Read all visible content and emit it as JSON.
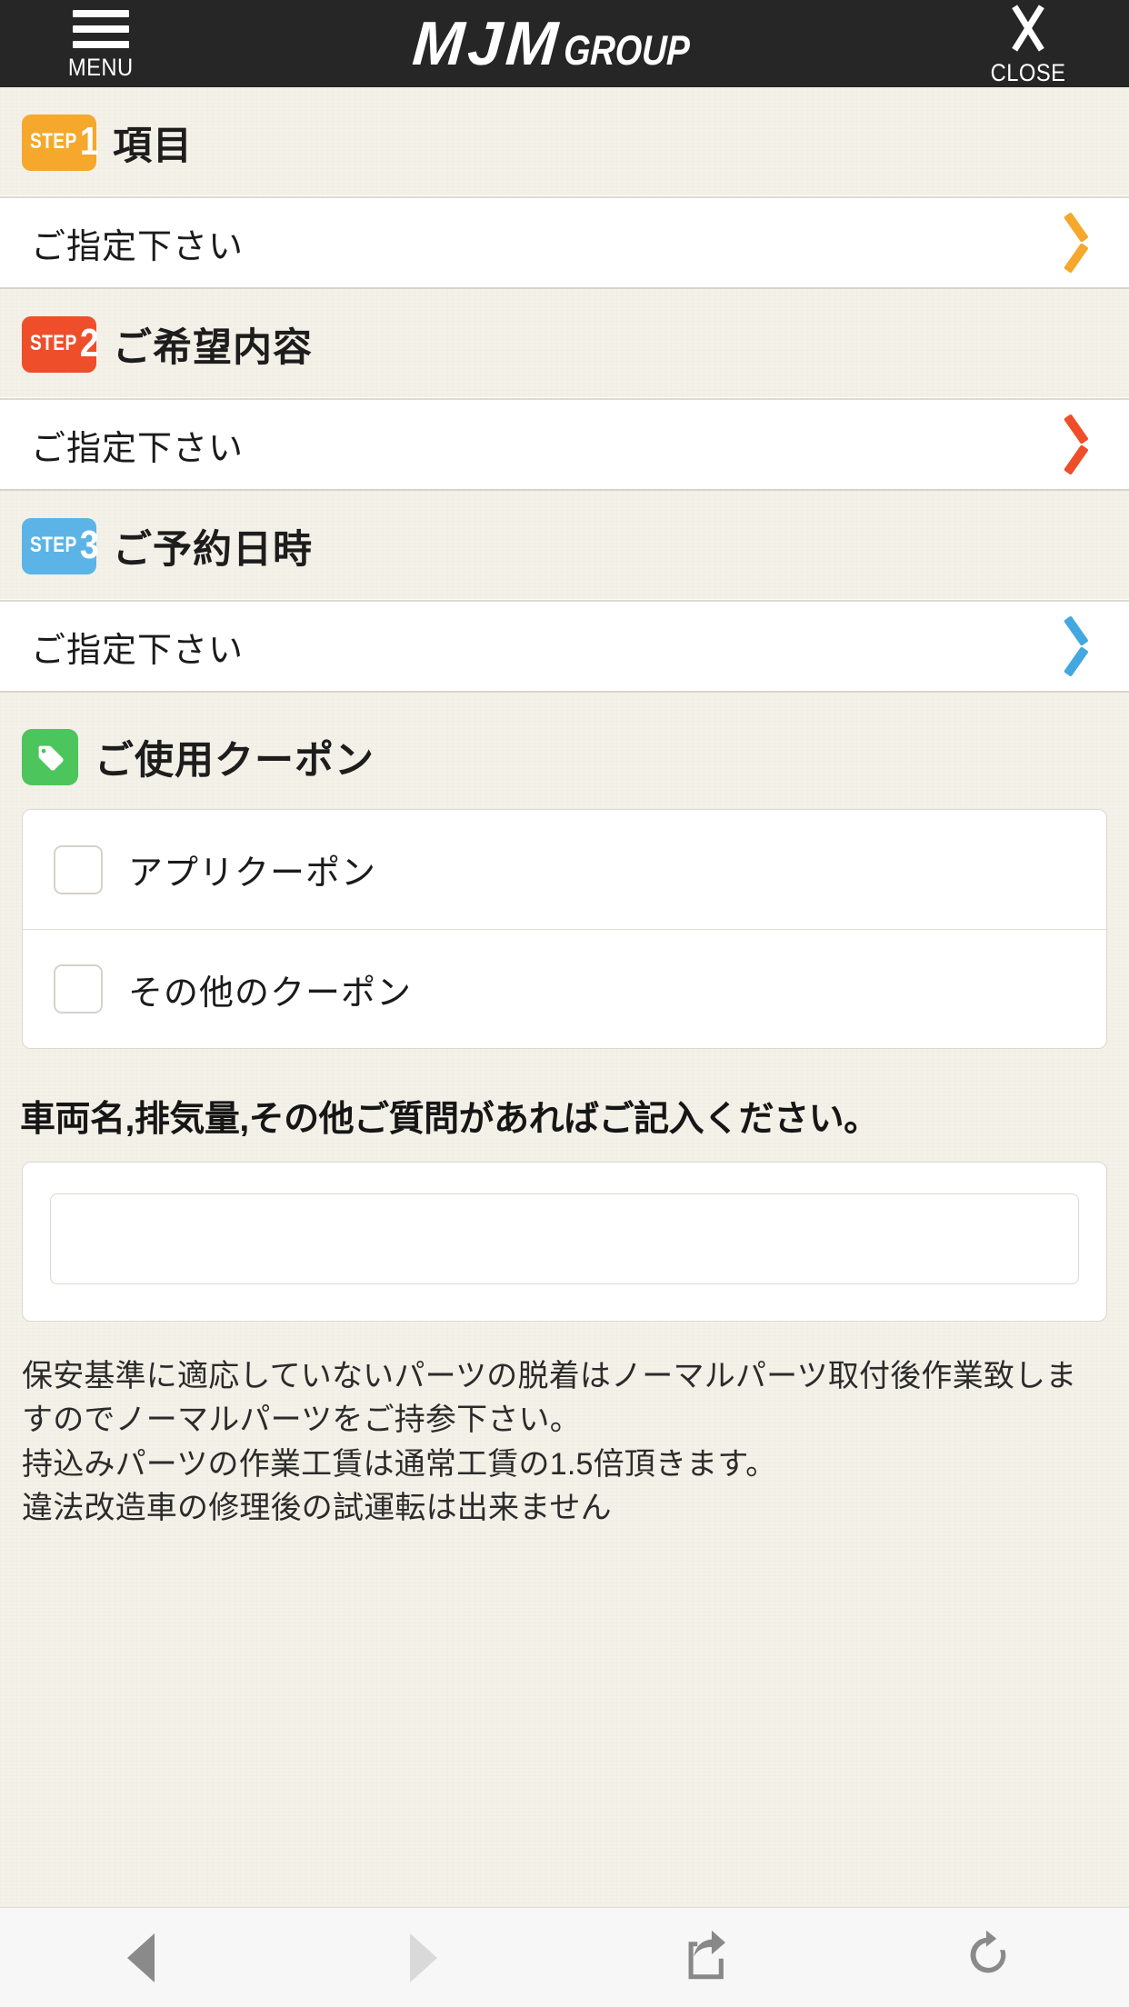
{
  "header": {
    "menu_label": "MENU",
    "menu_icon": "hamburger-icon",
    "logo_primary": "MJM",
    "logo_secondary": "GROUP",
    "close_label": "CLOSE",
    "close_icon": "close-x-icon",
    "background_color": "#262626"
  },
  "steps": [
    {
      "badge_step": "STEP",
      "badge_number": "1",
      "title": "項目",
      "value": "ご指定下さい",
      "color": "#f5a82b",
      "chevron_icon": "chevron-right-icon"
    },
    {
      "badge_step": "STEP",
      "badge_number": "2",
      "title": "ご希望内容",
      "value": "ご指定下さい",
      "color": "#ee4e2a",
      "chevron_icon": "chevron-right-icon"
    },
    {
      "badge_step": "STEP",
      "badge_number": "3",
      "title": "ご予約日時",
      "value": "ご指定下さい",
      "color": "#5bb4e5",
      "chevron_icon": "chevron-right-icon"
    }
  ],
  "coupon": {
    "icon": "price-tag-icon",
    "icon_color": "#4cc55c",
    "title": "ご使用クーポン",
    "items": [
      {
        "label": "アプリクーポン",
        "checked": false
      },
      {
        "label": "その他のクーポン",
        "checked": false
      }
    ]
  },
  "free_text": {
    "title": "車両名,排気量,その他ご質問があればご記入ください。",
    "value": "",
    "placeholder": ""
  },
  "notice": {
    "line1": "保安基準に適応していないパーツの脱着はノーマルパーツ取付後作業致しますのでノーマルパーツをご持参下さい。",
    "line2": "持込みパーツの作業工賃は通常工賃の1.5倍頂きます。",
    "line3": "違法改造車の修理後の試運転は出来ません"
  },
  "toolbar": {
    "back_icon": "back-arrow-icon",
    "forward_icon": "forward-arrow-icon",
    "share_icon": "share-icon",
    "reload_icon": "reload-icon",
    "back_enabled": "true",
    "forward_enabled": "false"
  }
}
